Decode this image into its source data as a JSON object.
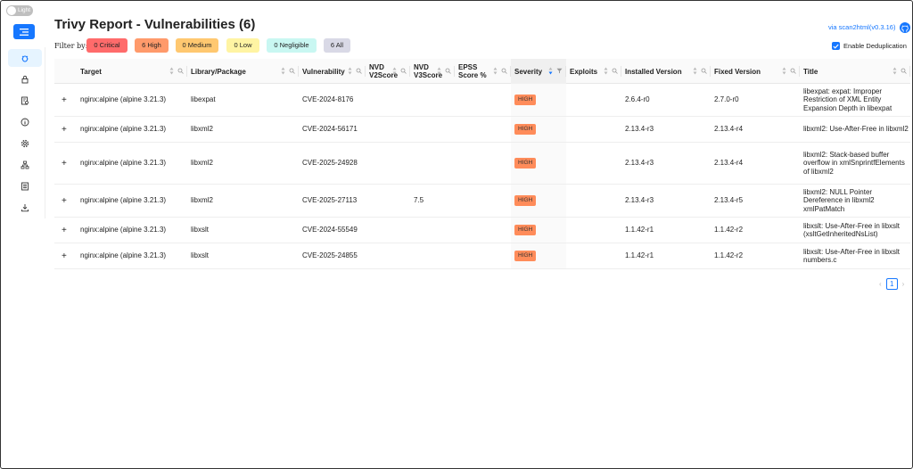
{
  "theme_toggle": {
    "label": "Light"
  },
  "header": {
    "title": "Trivy Report - Vulnerabilities (6)",
    "link": "via scan2html(v0.3.16)"
  },
  "filter": {
    "label": "Filter by:",
    "chips": [
      {
        "label": "0 Critical",
        "color": "#ff6b6b"
      },
      {
        "label": "6 High",
        "color": "#ff9a6b"
      },
      {
        "label": "0 Medium",
        "color": "#ffc870"
      },
      {
        "label": "0 Low",
        "color": "#fff4a3"
      },
      {
        "label": "0 Negligible",
        "color": "#c9f7f2"
      },
      {
        "label": "6 All",
        "color": "#d9d9e6"
      }
    ]
  },
  "dedup": {
    "label": "Enable Deduplication",
    "checked": true
  },
  "sidebar": {
    "items": [
      {
        "icon": "bug-icon",
        "active": true
      },
      {
        "icon": "lock-icon"
      },
      {
        "icon": "file-audit-icon"
      },
      {
        "icon": "info-icon"
      },
      {
        "icon": "gear-icon"
      },
      {
        "icon": "hierarchy-icon"
      },
      {
        "icon": "list-icon"
      },
      {
        "icon": "download-icon"
      }
    ]
  },
  "table": {
    "columns": [
      {
        "label": "Target"
      },
      {
        "label": "Library/Package"
      },
      {
        "label": "Vulnerability"
      },
      {
        "label": "NVD V2Score"
      },
      {
        "label": "NVD V3Score"
      },
      {
        "label": "EPSS Score %"
      },
      {
        "label": "Severity"
      },
      {
        "label": "Exploits"
      },
      {
        "label": "Installed Version"
      },
      {
        "label": "Fixed Version"
      },
      {
        "label": "Title"
      }
    ],
    "rows": [
      {
        "target": "nginx:alpine (alpine 3.21.3)",
        "pkg": "libexpat",
        "vuln": "CVE-2024-8176",
        "v2": "",
        "v3": "",
        "epss": "",
        "severity": "HIGH",
        "exploits": "",
        "installed": "2.6.4-r0",
        "fixed": "2.7.0-r0",
        "title": "libexpat: expat: Improper Restriction of XML Entity Expansion Depth in libexpat"
      },
      {
        "target": "nginx:alpine (alpine 3.21.3)",
        "pkg": "libxml2",
        "vuln": "CVE-2024-56171",
        "v2": "",
        "v3": "",
        "epss": "",
        "severity": "HIGH",
        "exploits": "",
        "installed": "2.13.4-r3",
        "fixed": "2.13.4-r4",
        "title": "libxml2: Use-After-Free in libxml2"
      },
      {
        "target": "nginx:alpine (alpine 3.21.3)",
        "pkg": "libxml2",
        "vuln": "CVE-2025-24928",
        "v2": "",
        "v3": "",
        "epss": "",
        "severity": "HIGH",
        "exploits": "",
        "installed": "2.13.4-r3",
        "fixed": "2.13.4-r4",
        "title": "libxml2: Stack-based buffer overflow in xmlSnprintfElements of libxml2"
      },
      {
        "target": "nginx:alpine (alpine 3.21.3)",
        "pkg": "libxml2",
        "vuln": "CVE-2025-27113",
        "v2": "",
        "v3": "7.5",
        "epss": "",
        "severity": "HIGH",
        "exploits": "",
        "installed": "2.13.4-r3",
        "fixed": "2.13.4-r5",
        "title": "libxml2: NULL Pointer Dereference in libxml2 xmlPatMatch"
      },
      {
        "target": "nginx:alpine (alpine 3.21.3)",
        "pkg": "libxslt",
        "vuln": "CVE-2024-55549",
        "v2": "",
        "v3": "",
        "epss": "",
        "severity": "HIGH",
        "exploits": "",
        "installed": "1.1.42-r1",
        "fixed": "1.1.42-r2",
        "title": "libxslt: Use-After-Free in libxslt (xsltGetInheritedNsList)"
      },
      {
        "target": "nginx:alpine (alpine 3.21.3)",
        "pkg": "libxslt",
        "vuln": "CVE-2025-24855",
        "v2": "",
        "v3": "",
        "epss": "",
        "severity": "HIGH",
        "exploits": "",
        "installed": "1.1.42-r1",
        "fixed": "1.1.42-r2",
        "title": "libxslt: Use-After-Free in libxslt numbers.c"
      }
    ]
  },
  "pagination": {
    "current": "1",
    "prev": "‹",
    "next": "›"
  }
}
